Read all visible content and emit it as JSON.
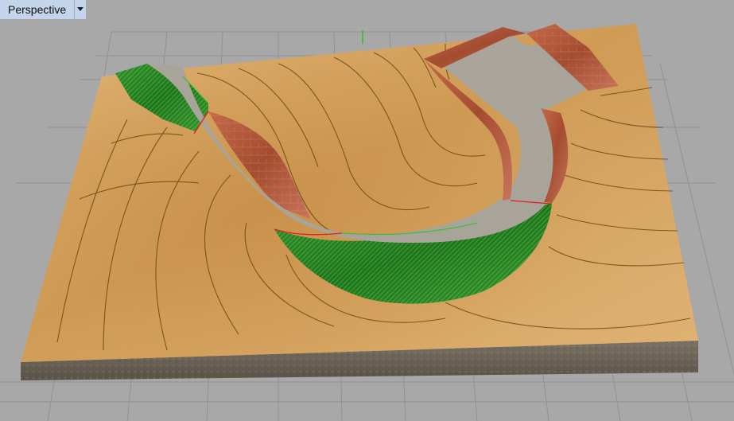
{
  "viewport": {
    "title": "Perspective",
    "menu_icon": "chevron-down-icon",
    "colors": {
      "background": "#a8a8a8",
      "grid": "#8f8f8f",
      "terrain": "#d6a45f",
      "contour": "#6b4a12",
      "road": "#a8a49a",
      "grass": "#2e8a2a",
      "brick": "#b45a3c",
      "soil": "#6d6458",
      "axis_green": "#27c22a",
      "edge_red": "#e02020"
    }
  }
}
